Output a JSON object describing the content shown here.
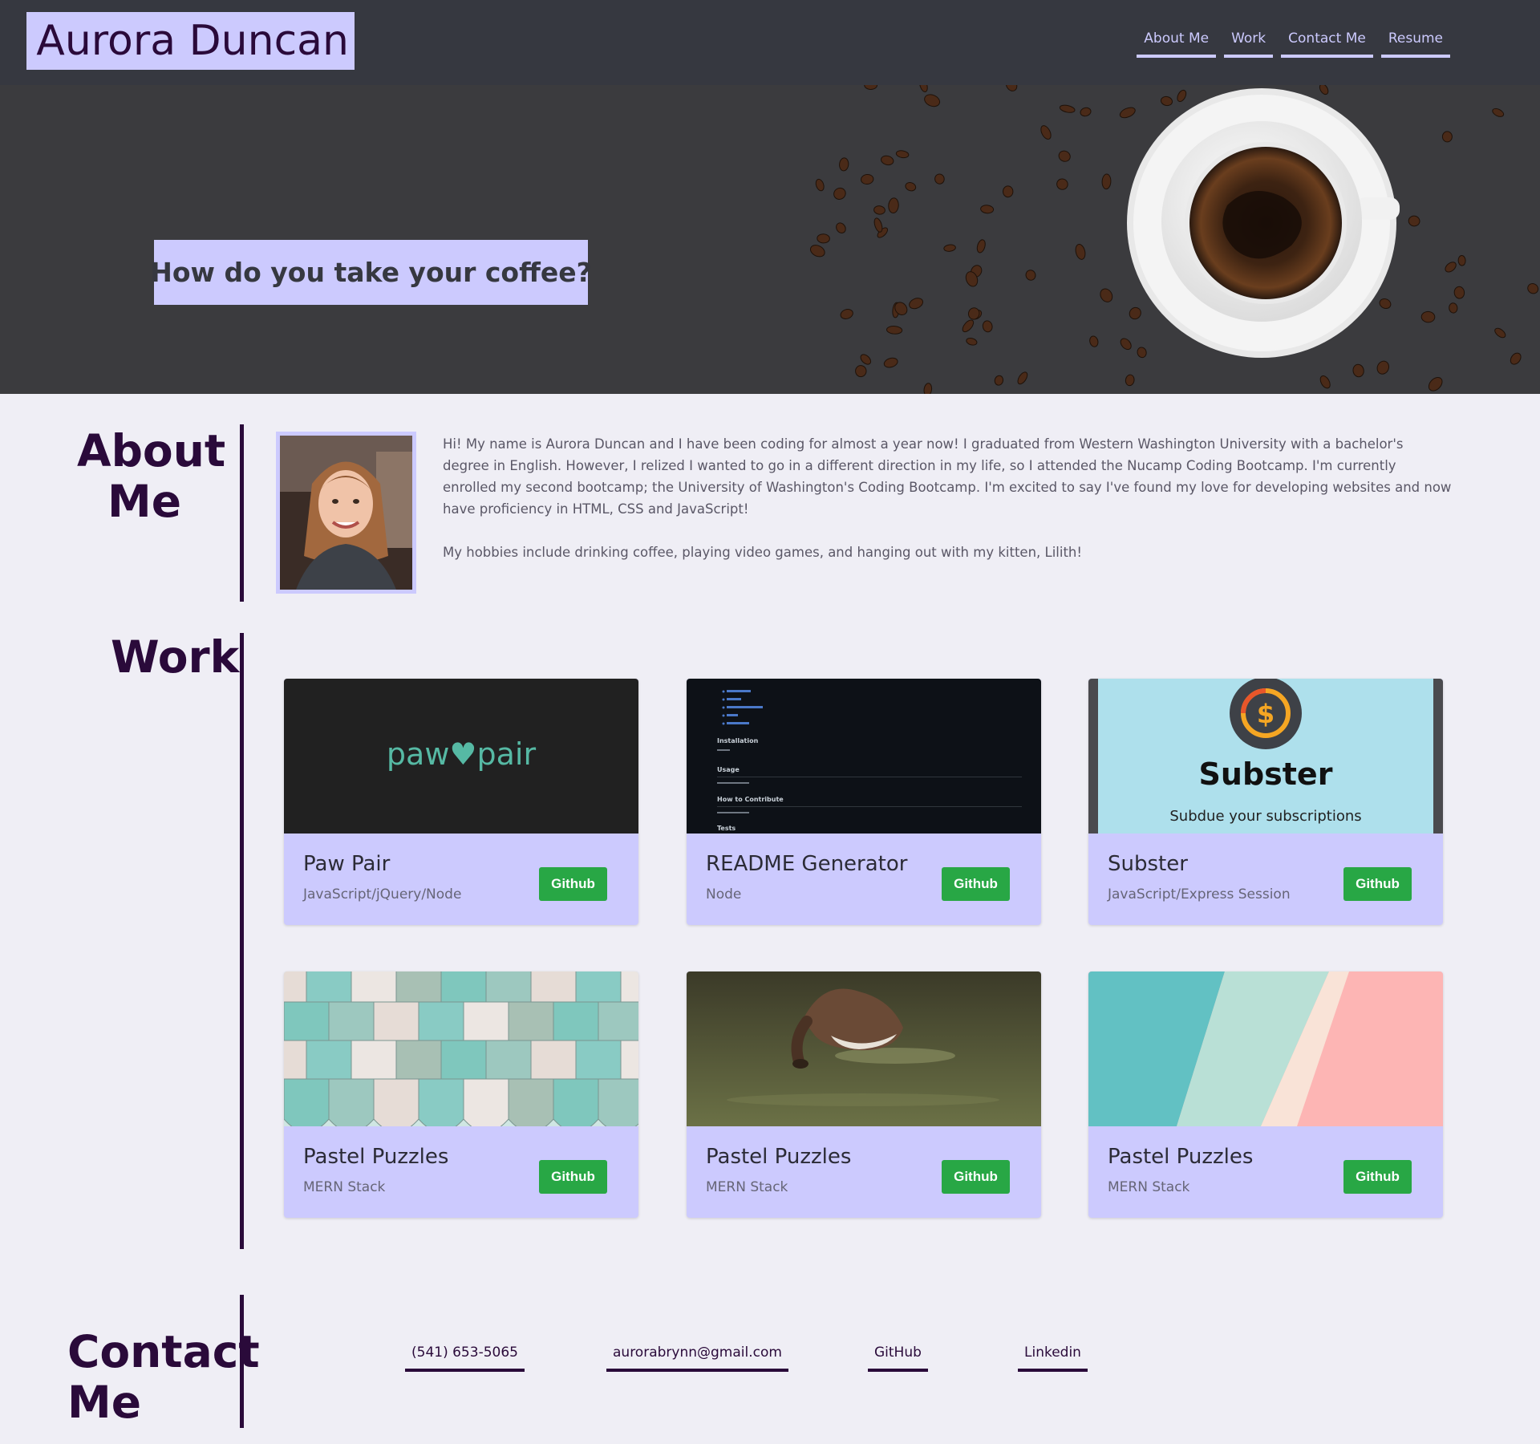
{
  "header": {
    "brand": "Aurora Duncan",
    "nav": [
      "About Me",
      "Work",
      "Contact Me",
      "Resume"
    ]
  },
  "hero": {
    "tagline": "How do you take your coffee?"
  },
  "about": {
    "title_line1": "About",
    "title_line2": "Me",
    "paragraph1": "Hi! My name is Aurora Duncan and I have been coding for almost a year now! I graduated from Western Washington University with a bachelor's degree in English. However, I relized I wanted to go in a different direction in my life, so I attended the Nucamp Coding Bootcamp. I'm currently enrolled my second bootcamp; the University of Washington's Coding Bootcamp. I'm excited to say I've found my love for developing websites and now have proficiency in HTML, CSS and JavaScript!",
    "paragraph2": "My hobbies include drinking coffee, playing video games, and hanging out with my kitten, Lilith!"
  },
  "work": {
    "title": "Work",
    "button_label": "Github",
    "cards": [
      {
        "title": "Paw Pair",
        "stack": "JavaScript/jQuery/Node",
        "image_text": "paw♥pair"
      },
      {
        "title": "README Generator",
        "stack": "Node",
        "image_lines": [
          "Installation",
          "Usage",
          "How to Contribute",
          "Tests"
        ]
      },
      {
        "title": "Subster",
        "stack": "JavaScript/Express Session",
        "image_title": "Subster",
        "image_tagline": "Subdue your subscriptions"
      },
      {
        "title": "Pastel Puzzles",
        "stack": "MERN Stack"
      },
      {
        "title": "Pastel Puzzles",
        "stack": "MERN Stack"
      },
      {
        "title": "Pastel Puzzles",
        "stack": "MERN Stack"
      }
    ]
  },
  "contact": {
    "title_line1": "Contact",
    "title_line2": "Me",
    "phone": "(541) 653-5065",
    "email": "aurorabrynn@gmail.com",
    "github": "GitHub",
    "linkedin": "Linkedin"
  },
  "colors": {
    "header_bg": "#363840",
    "accent_lavender": "#cccafe",
    "text_dark_purple": "#2a0a3a",
    "page_bg": "#efeef5",
    "button_green": "#28a745"
  }
}
